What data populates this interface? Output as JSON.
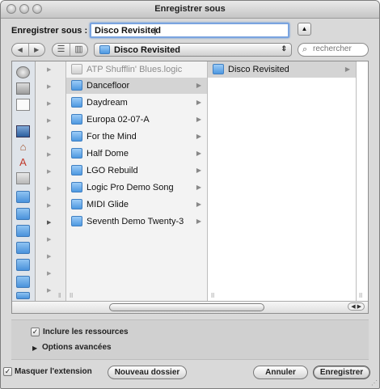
{
  "window": {
    "title": "Enregistrer sous"
  },
  "save": {
    "label": "Enregistrer sous :",
    "filename": "Disco Revisited",
    "expand_glyph": "▲"
  },
  "toolbar": {
    "back_glyph": "◀",
    "forward_glyph": "▶",
    "list_view_glyph": "☰",
    "column_view_glyph": "▥",
    "path_popup_value": "Disco Revisited",
    "path_popup_arrows": "⇕",
    "search_placeholder": "rechercher",
    "search_glyph": "🔍"
  },
  "columns": {
    "main": [
      {
        "label": "ATP Shufflin' Blues.logic",
        "type": "file",
        "dim": true,
        "selected": false,
        "chevron": ""
      },
      {
        "label": "Dancefloor",
        "type": "folder",
        "dim": false,
        "selected": true,
        "chevron": "▶"
      },
      {
        "label": "Daydream",
        "type": "folder",
        "dim": false,
        "selected": false,
        "chevron": "▶"
      },
      {
        "label": "Europa 02-07-A",
        "type": "folder",
        "dim": false,
        "selected": false,
        "chevron": "▶"
      },
      {
        "label": "For the Mind",
        "type": "folder",
        "dim": false,
        "selected": false,
        "chevron": "▶"
      },
      {
        "label": "Half Dome",
        "type": "folder",
        "dim": false,
        "selected": false,
        "chevron": "▶"
      },
      {
        "label": "LGO Rebuild",
        "type": "folder",
        "dim": false,
        "selected": false,
        "chevron": "▶"
      },
      {
        "label": "Logic Pro Demo Song",
        "type": "folder",
        "dim": false,
        "selected": false,
        "chevron": "▶"
      },
      {
        "label": "MIDI Glide",
        "type": "folder",
        "dim": false,
        "selected": false,
        "chevron": "▶"
      },
      {
        "label": "Seventh Demo Twenty-3",
        "type": "folder",
        "dim": false,
        "selected": false,
        "chevron": "▶"
      }
    ],
    "right": [
      {
        "label": "Disco Revisited",
        "type": "folder",
        "chevron": "▶"
      }
    ]
  },
  "options": {
    "include_resources_label": "Inclure les ressources",
    "include_resources_checked": true,
    "advanced_label": "Options avancées",
    "disclosure_glyph": "▶"
  },
  "footer": {
    "hide_extension_label": "Masquer l'extension",
    "hide_extension_checked": true,
    "new_folder_label": "Nouveau dossier",
    "cancel_label": "Annuler",
    "save_label": "Enregistrer"
  },
  "glyphs": {
    "check": "✓",
    "row_chevron": "▶",
    "scroll_arrows": "◀ ▶"
  }
}
